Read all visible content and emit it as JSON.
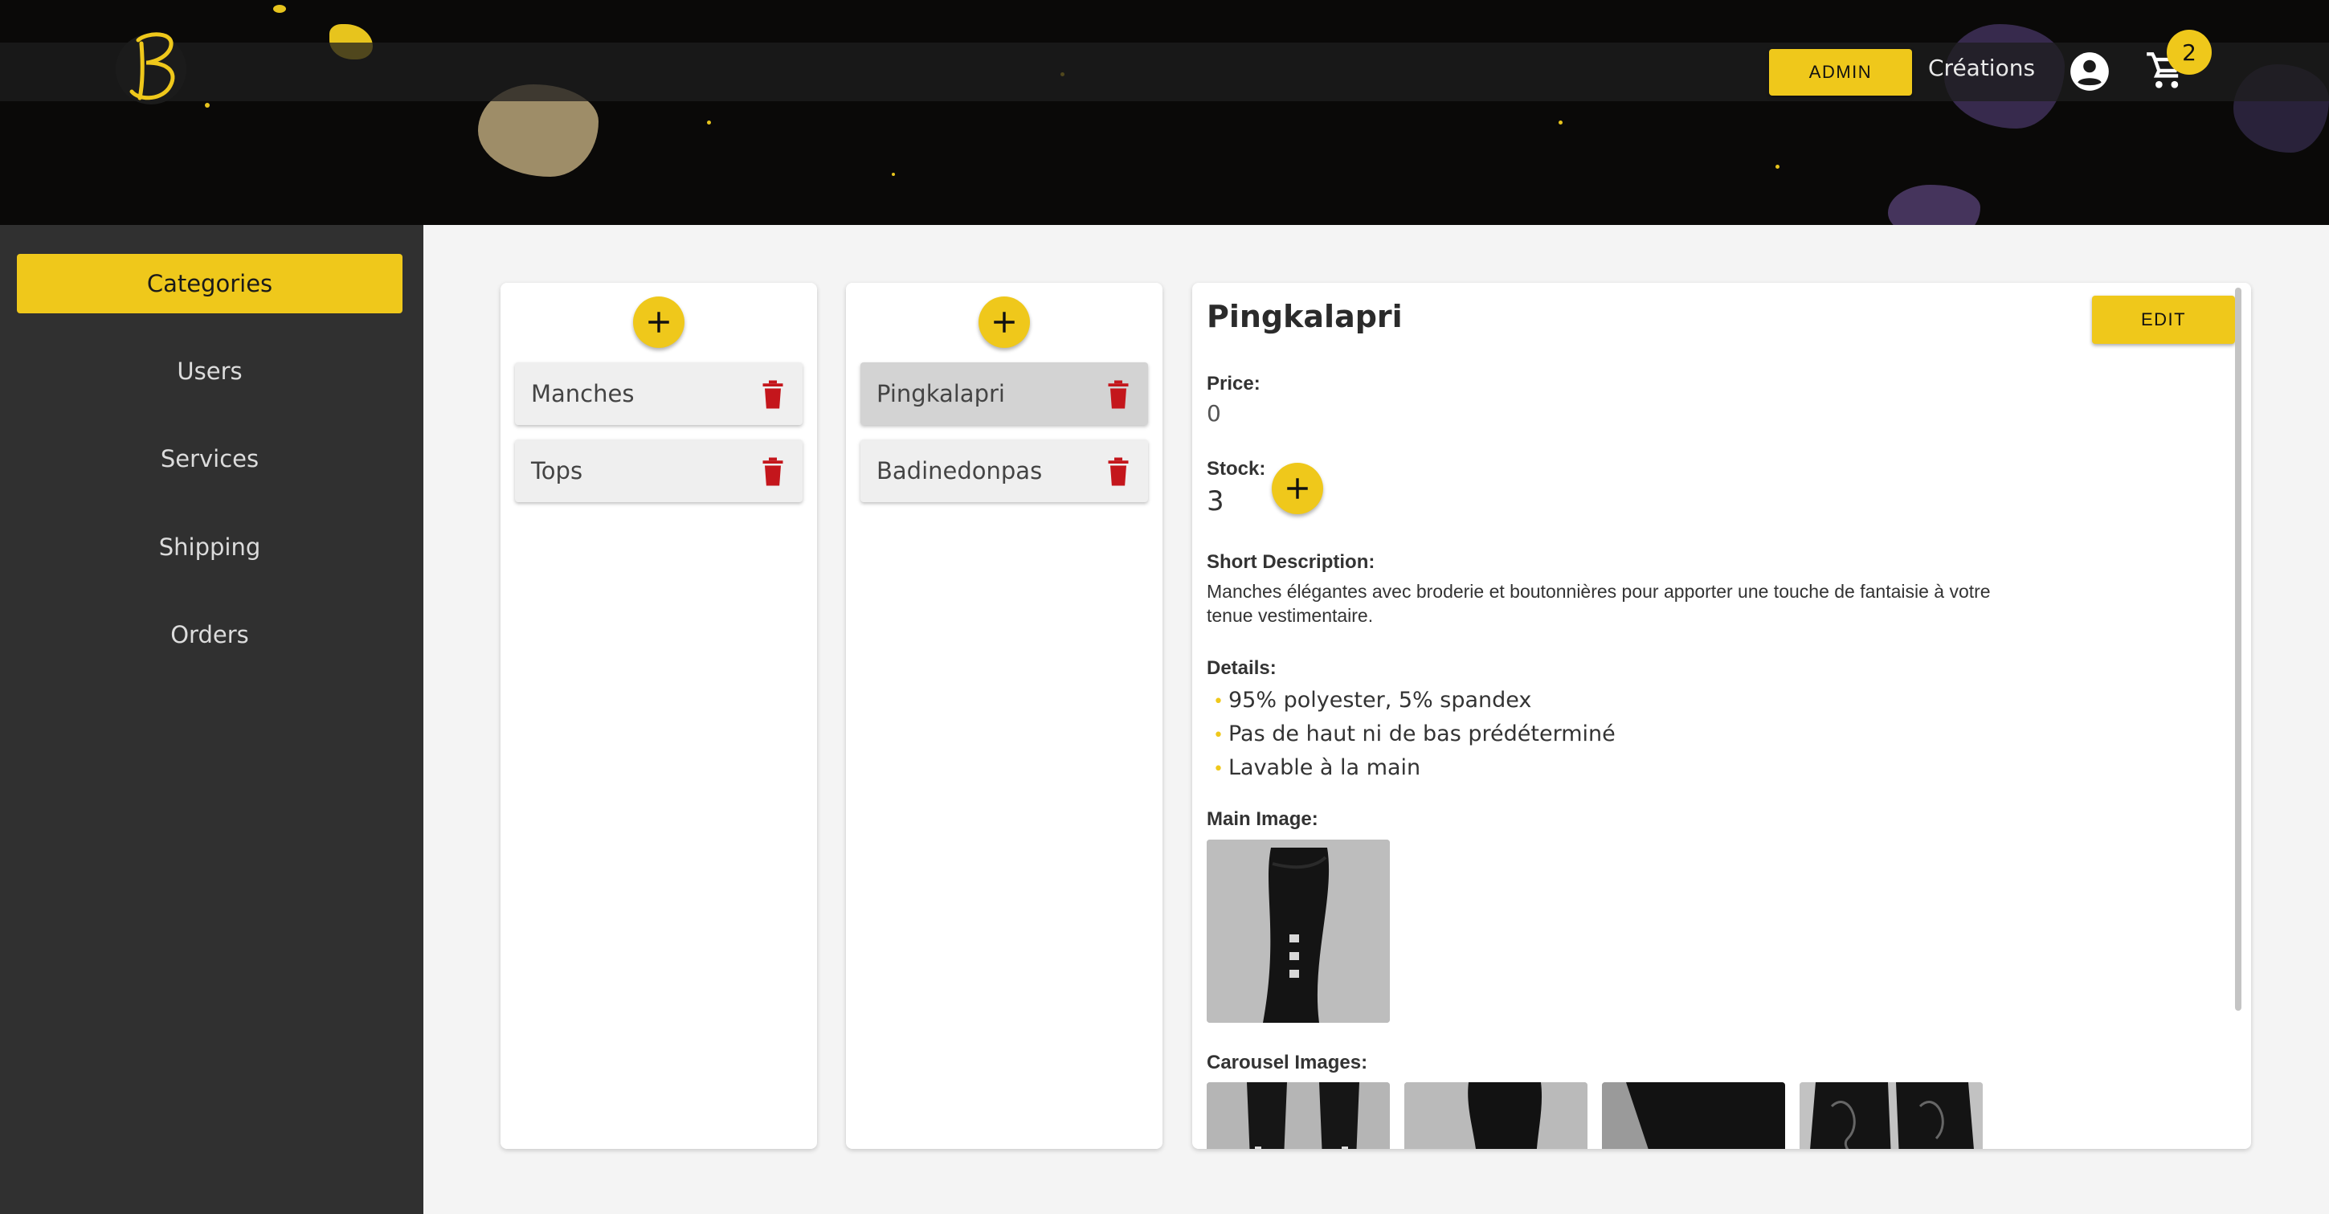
{
  "header": {
    "logo_letter": "B",
    "admin_label": "ADMIN",
    "creations_label": "Créations",
    "cart_count": "2",
    "brand_color": "#efc81b",
    "icons": [
      "account-circle-icon",
      "shopping-cart-icon"
    ]
  },
  "sidebar": {
    "items": [
      {
        "label": "Categories",
        "active": true
      },
      {
        "label": "Users",
        "active": false
      },
      {
        "label": "Services",
        "active": false
      },
      {
        "label": "Shipping",
        "active": false
      },
      {
        "label": "Orders",
        "active": false
      }
    ]
  },
  "categories": {
    "items": [
      {
        "label": "Manches"
      },
      {
        "label": "Tops"
      }
    ]
  },
  "products": {
    "items": [
      {
        "label": "Pingkalapri",
        "selected": true
      },
      {
        "label": "Badinedonpas",
        "selected": false
      }
    ]
  },
  "detail": {
    "title": "Pingkalapri",
    "edit_label": "EDIT",
    "price_label": "Price:",
    "price_value": "0",
    "stock_label": "Stock:",
    "stock_value": "3",
    "short_desc_label": "Short Description:",
    "short_desc": "Manches élégantes avec broderie et boutonnières pour apporter une touche de fantaisie à votre tenue vestimentaire.",
    "details_label": "Details:",
    "details": [
      "95% polyester, 5% spandex",
      "Pas de haut ni de bas prédéterminé",
      "Lavable à la main"
    ],
    "main_image_label": "Main Image:",
    "carousel_label": "Carousel Images:"
  }
}
